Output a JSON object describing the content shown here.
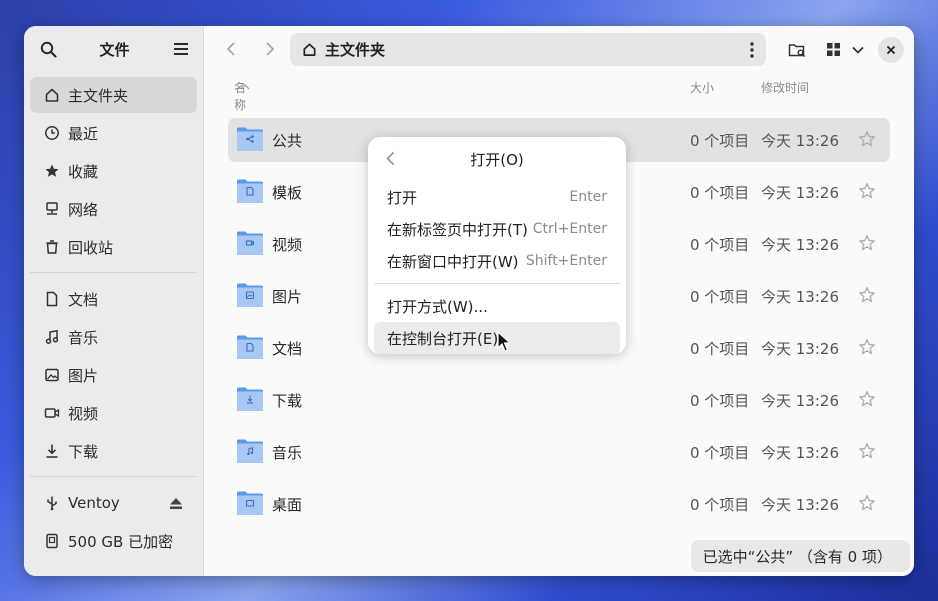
{
  "sidebar": {
    "title": "文件",
    "places": [
      {
        "label": "主文件夹",
        "icon": "home-icon"
      },
      {
        "label": "最近",
        "icon": "clock-icon"
      },
      {
        "label": "收藏",
        "icon": "star-icon"
      },
      {
        "label": "网络",
        "icon": "network-icon"
      },
      {
        "label": "回收站",
        "icon": "trash-icon"
      }
    ],
    "bookmarks": [
      {
        "label": "文档",
        "icon": "document-icon"
      },
      {
        "label": "音乐",
        "icon": "music-icon"
      },
      {
        "label": "图片",
        "icon": "image-icon"
      },
      {
        "label": "视频",
        "icon": "video-icon"
      },
      {
        "label": "下载",
        "icon": "download-icon"
      }
    ],
    "devices": [
      {
        "label": "Ventoy",
        "icon": "usb-icon"
      },
      {
        "label": "500 GB 已加密",
        "icon": "drive-icon"
      }
    ]
  },
  "pathbar": {
    "title": "主文件夹"
  },
  "columns": {
    "name": "名称",
    "size": "大小",
    "modified": "修改时间"
  },
  "files": [
    {
      "name": "公共",
      "size": "0 个项目",
      "date": "今天 13:26",
      "icon": "share-icon"
    },
    {
      "name": "模板",
      "size": "0 个项目",
      "date": "今天 13:26",
      "icon": "template-icon"
    },
    {
      "name": "视频",
      "size": "0 个项目",
      "date": "今天 13:26",
      "icon": "video-icon"
    },
    {
      "name": "图片",
      "size": "0 个项目",
      "date": "今天 13:26",
      "icon": "image-icon"
    },
    {
      "name": "文档",
      "size": "0 个项目",
      "date": "今天 13:26",
      "icon": "document-icon"
    },
    {
      "name": "下载",
      "size": "0 个项目",
      "date": "今天 13:26",
      "icon": "download-icon"
    },
    {
      "name": "音乐",
      "size": "0 个项目",
      "date": "今天 13:26",
      "icon": "music-icon"
    },
    {
      "name": "桌面",
      "size": "0 个项目",
      "date": "今天 13:26",
      "icon": "desktop-icon"
    }
  ],
  "status": "已选中“公共” （含有 0 项）",
  "popover": {
    "title": "打开(O)",
    "items": [
      {
        "label": "打开",
        "accel": "Enter"
      },
      {
        "label": "在新标签页中打开(T)",
        "accel": "Ctrl+Enter"
      },
      {
        "label": "在新窗口中打开(W)",
        "accel": "Shift+Enter"
      }
    ],
    "items2": [
      {
        "label": "打开方式(W)...",
        "accel": ""
      },
      {
        "label": "在控制台打开(E)",
        "accel": ""
      }
    ]
  },
  "colors": {
    "folder": "#5b9be6",
    "folder_light": "#a6c8f3",
    "selected_row": "#e2e2e4"
  }
}
